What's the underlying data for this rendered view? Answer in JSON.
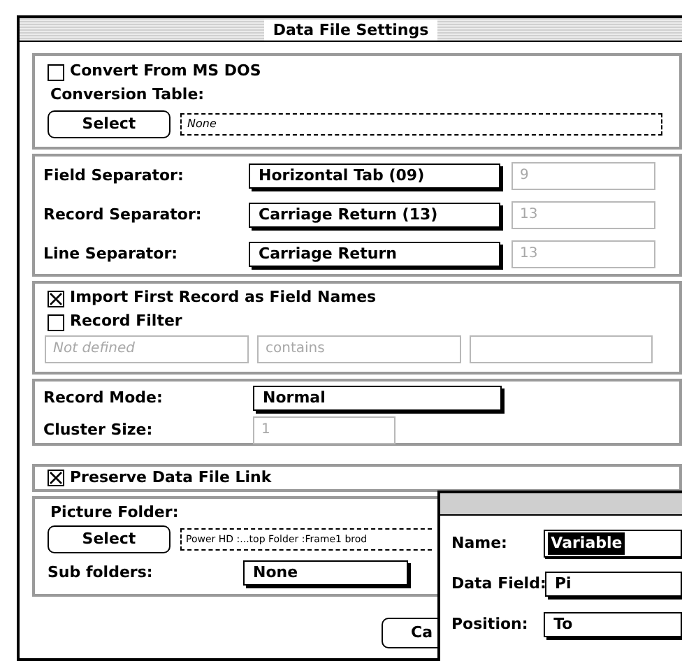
{
  "window": {
    "title": "Data File Settings"
  },
  "conversion": {
    "convert_checkbox": {
      "label": "Convert From MS DOS",
      "checked": false
    },
    "table_label": "Conversion Table:",
    "select_button": "Select",
    "table_field": {
      "value": "None"
    }
  },
  "separators": [
    {
      "label": "Field Separator:",
      "popup": "Horizontal Tab (09)",
      "code": {
        "value": "9",
        "disabled": true
      }
    },
    {
      "label": "Record Separator:",
      "popup": "Carriage Return (13)",
      "code": {
        "value": "13",
        "disabled": true
      }
    },
    {
      "label": "Line Separator:",
      "popup": "Carriage Return",
      "code": {
        "value": "13",
        "disabled": true
      }
    }
  ],
  "import": {
    "first_record": {
      "label": "Import First Record as Field Names",
      "checked": true
    },
    "record_filter": {
      "label": "Record Filter",
      "checked": false
    },
    "filter_field": {
      "value": "Not defined",
      "disabled": true
    },
    "filter_operator": {
      "value": "contains",
      "disabled": true
    }
  },
  "record": {
    "mode_label": "Record Mode:",
    "mode_popup": "Normal",
    "cluster_label": "Cluster Size:",
    "cluster_field": {
      "value": "1",
      "disabled": true
    }
  },
  "preserve_link": {
    "label": "Preserve Data File Link",
    "checked": true
  },
  "picture_folder": {
    "label": "Picture Folder:",
    "select_button": "Select",
    "path": "Power HD :...top Folder :Frame1 brod",
    "subfolders_label": "Sub folders:",
    "subfolders_popup": "None"
  },
  "buttons": [
    "Ca"
  ],
  "variable_window": {
    "rows": [
      {
        "kind": "field",
        "label": "Name:",
        "value": "Variable",
        "text_selected": true
      },
      {
        "kind": "popup",
        "label": "Data Field:",
        "value": "Pi"
      },
      {
        "kind": "popup",
        "label": "Position:",
        "value": "To"
      }
    ]
  }
}
